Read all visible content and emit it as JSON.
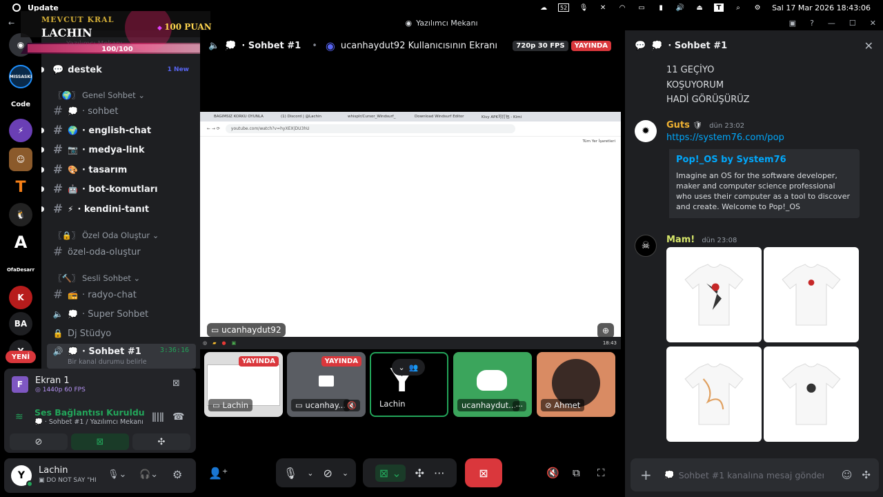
{
  "os": {
    "app_name": "Update",
    "datetime": "Sal 17 Mar 2026 18:43:06",
    "tray_badge": "52"
  },
  "window": {
    "title": "Yazılımcı Mekanı"
  },
  "overlay": {
    "rank": "MEVCUT KRAL",
    "name": "LACHIN",
    "points": "100 PUAN",
    "progress_text": "100/100",
    "progress": 1.0,
    "faded_text": "Yazılımcı Mekanı"
  },
  "rail": {
    "items": [
      {
        "label": "",
        "icon": "discord-home-icon"
      },
      {
        "label": "MISSASKI",
        "icon": "server-missaski-icon"
      },
      {
        "label": "Code",
        "icon": "server-code-icon"
      },
      {
        "label": "",
        "icon": "server-purple-icon"
      },
      {
        "label": "",
        "icon": "server-minecraft-icon"
      },
      {
        "label": "",
        "icon": "server-orange-icon"
      },
      {
        "label": "",
        "icon": "server-penguin-icon"
      },
      {
        "label": "A",
        "icon": "server-a-icon"
      },
      {
        "label": "OfaDesarr",
        "icon": "server-text-icon"
      },
      {
        "label": "",
        "icon": "server-red-icon"
      },
      {
        "label": "BA",
        "icon": "server-ba-icon"
      },
      {
        "label": "YENİ",
        "icon": "new-badge"
      }
    ]
  },
  "sidebar": {
    "top_channel": {
      "label": "destek",
      "badge": "1 New"
    },
    "categories": [
      {
        "label": "Genel Sohbet",
        "channels": [
          {
            "label": "· sohbet",
            "emoji": "💭",
            "bold": false
          },
          {
            "label": "· english-chat",
            "emoji": "🌍",
            "bold": true
          },
          {
            "label": "· medya-link",
            "emoji": "📷",
            "bold": true
          },
          {
            "label": "· tasarım",
            "emoji": "🎨",
            "bold": true
          },
          {
            "label": "· bot-komutları",
            "emoji": "🤖",
            "bold": true
          },
          {
            "label": "· kendini-tanıt",
            "emoji": "⚡",
            "bold": true
          }
        ]
      },
      {
        "label": "Özel Oda Oluştur",
        "channels": [
          {
            "label": "özel-oda-oluştur",
            "emoji": "",
            "bold": false
          }
        ]
      },
      {
        "label": "Sesli Sohbet",
        "channels": [
          {
            "label": "· radyo-chat",
            "emoji": "📻",
            "bold": false
          },
          {
            "label": "· Super Sohbet",
            "emoji": "💭",
            "bold": false
          },
          {
            "label": "Dj Stüdyo",
            "emoji": "",
            "bold": false
          },
          {
            "label": "· Sohbet #1",
            "emoji": "💭",
            "bold": true,
            "timer": "3:36:16",
            "status": "Bir kanal durumu belirle"
          }
        ]
      }
    ]
  },
  "voice_panel": {
    "stream_title": "Ekran 1",
    "stream_quality": "1440p 60 FPS",
    "connection_status": "Ses Bağlantısı Kuruldu",
    "connection_channel": "Sohbet #1 / Yazılımcı Mekanı"
  },
  "user": {
    "name": "Lachin",
    "status": "DO NOT SAY \"HI"
  },
  "stage": {
    "channel": "· Sohbet #1",
    "separator": "•",
    "stream_owner": "ucanhaydut92 Kullanıcısının Ekranı",
    "quality_badge": "720p 30 FPS",
    "live_badge": "YAYINDA",
    "main_label": "ucanhaydut92",
    "browser": {
      "tabs": [
        "BAĞIMSIZ KORKU OYUNLA",
        "(1) Discord | @Lachin",
        "whisplr/Cursor_Windsurf_",
        "Download Windsurf Editor",
        "Kivy APK可打包 - Kimi"
      ],
      "url": "youtube.com/watch?v=hyXEX|DU3hU",
      "bookmarks": "Tüm Yer İşaretleri"
    },
    "taskbar_time": "18:43",
    "tiles": [
      {
        "name": "Lachin",
        "live": "YAYINDA"
      },
      {
        "name": "ucanhay...",
        "live": "YAYINDA"
      },
      {
        "name": "Lachin",
        "live": ""
      },
      {
        "name": "ucanhaydut...",
        "live": ""
      },
      {
        "name": "Ahmet",
        "live": ""
      }
    ]
  },
  "chat": {
    "channel": "· Sohbet #1",
    "lines": [
      "11 GEÇİYO",
      "KOŞUYORUM",
      "HADİ GÖRÜŞÜRÜZ"
    ],
    "messages": [
      {
        "author": "Guts",
        "author_color": "#f0b232",
        "time": "dün 23:02",
        "link": "https://system76.com/pop",
        "embed_title": "Pop!_OS by System76",
        "embed_desc": "Imagine an OS for the software developer, maker and computer science professional who uses their computer as a tool to discover and create. Welcome to Pop!_OS"
      },
      {
        "author": "Mam!",
        "author_color": "#d6e66a",
        "time": "dün 23:08"
      }
    ],
    "input_placeholder": "Sohbet #1 kanalına mesaj gönder"
  },
  "colors": {
    "accent": "#5865f2",
    "live_red": "#da373c",
    "green": "#23a55a",
    "tile_green": "#3ba55c"
  }
}
